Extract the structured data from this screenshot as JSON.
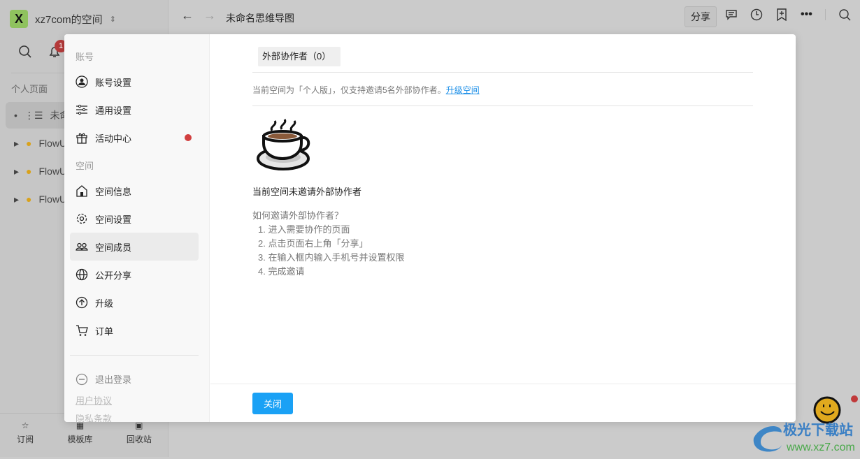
{
  "workspace": {
    "logo": "X",
    "name": "xz7com的空间"
  },
  "sidebar": {
    "notification_count": "1",
    "section": "个人页面",
    "items": [
      {
        "label": "未命名思维导图"
      },
      {
        "label": "FlowUs"
      },
      {
        "label": "FlowUs"
      },
      {
        "label": "FlowUs"
      }
    ],
    "bottom": [
      {
        "label": "订阅",
        "icon": "subscribe-icon"
      },
      {
        "label": "模板库",
        "icon": "template-icon"
      },
      {
        "label": "回收站",
        "icon": "trash-icon"
      }
    ]
  },
  "topbar": {
    "title": "未命名思维导图",
    "share": "分享"
  },
  "modal": {
    "left": {
      "section_account": "账号",
      "section_space": "空间",
      "account_items": [
        {
          "label": "账号设置",
          "icon": "user-circle-icon"
        },
        {
          "label": "通用设置",
          "icon": "sliders-icon"
        },
        {
          "label": "活动中心",
          "icon": "gift-icon"
        }
      ],
      "space_items": [
        {
          "label": "空间信息",
          "icon": "home-icon"
        },
        {
          "label": "空间设置",
          "icon": "gear-icon"
        },
        {
          "label": "空间成员",
          "icon": "members-icon"
        },
        {
          "label": "公开分享",
          "icon": "globe-icon"
        },
        {
          "label": "升级",
          "icon": "upgrade-icon"
        },
        {
          "label": "订单",
          "icon": "cart-icon"
        }
      ],
      "logout": "退出登录",
      "user_agreement": "用户协议",
      "privacy": "隐私条款",
      "active": "空间成员"
    },
    "right": {
      "tab": "外部协作者（0）",
      "notice": "当前空间为「个人版」，仅支持邀请5名外部协作者。",
      "upgrade_link": "升级空间",
      "empty": "当前空间未邀请外部协作者",
      "howto_title": "如何邀请外部协作者？",
      "steps": [
        "1. 进入需要协作的页面",
        "2. 点击页面右上角「分享」",
        "3. 在输入框内输入手机号并设置权限",
        "4. 完成邀请"
      ],
      "close": "关闭"
    }
  },
  "watermark": {
    "name": "极光下载站",
    "url": "www.xz7.com"
  },
  "colors": {
    "accent": "#1aa1f5",
    "dot": "#d13f3f",
    "logo": "#8fc25e"
  }
}
